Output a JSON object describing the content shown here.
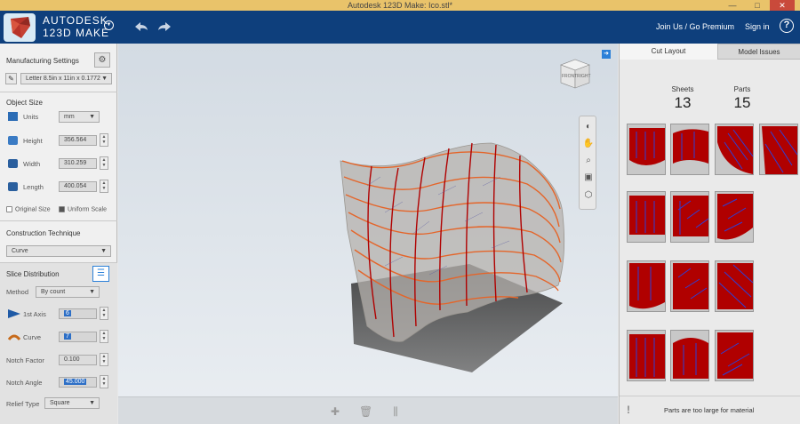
{
  "window": {
    "title": "Autodesk 123D Make: Ico.stl*"
  },
  "header": {
    "brand_line1": "AUTODESK",
    "brand_line2": "123D MAKE",
    "join_label": "Join Us / Go Premium",
    "signin_label": "Sign in",
    "help_label": "?"
  },
  "left": {
    "manufacturing": {
      "title": "Manufacturing Settings",
      "material": "Letter 8.5in x 11in x 0.1772"
    },
    "object_size": {
      "title": "Object Size",
      "units_label": "Units",
      "units_value": "mm",
      "height_label": "Height",
      "height_value": "356.564",
      "width_label": "Width",
      "width_value": "310.259",
      "length_label": "Length",
      "length_value": "400.054",
      "original_size_label": "Original Size",
      "uniform_scale_label": "Uniform Scale"
    },
    "construction": {
      "title": "Construction Technique",
      "value": "Curve"
    },
    "slice": {
      "title": "Slice Distribution",
      "method_label": "Method",
      "method_value": "By count",
      "axis_label": "1st Axis",
      "axis_value": "6",
      "curve_label": "Curve",
      "curve_value": "7",
      "notch_factor_label": "Notch Factor",
      "notch_factor_value": "0.100",
      "notch_angle_label": "Notch Angle",
      "notch_angle_value": "45.000",
      "relief_label": "Relief Type",
      "relief_value": "Square"
    }
  },
  "viewcube": {
    "front": "FRONT",
    "right": "RIGHT"
  },
  "right": {
    "tabs": [
      "Cut Layout",
      "Model Issues"
    ],
    "sheets_label": "Sheets",
    "sheets_value": "13",
    "parts_label": "Parts",
    "parts_value": "15",
    "warning": "Parts are too large for material"
  },
  "colors": {
    "header": "#0e3f7c",
    "part_red": "#b00000",
    "accent_blue": "#2b80d8"
  }
}
